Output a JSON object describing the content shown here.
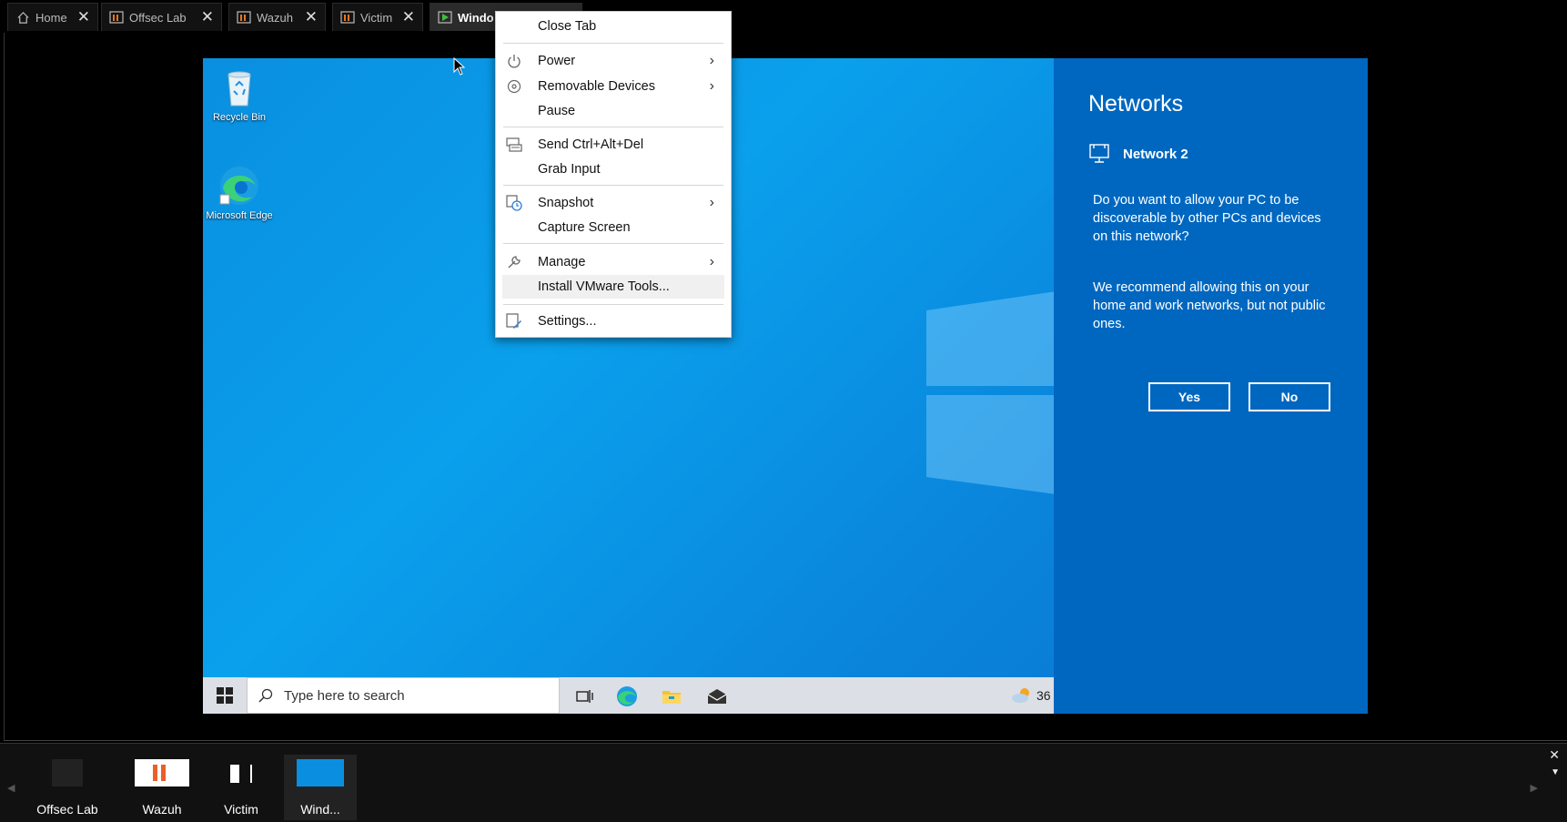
{
  "tabs": [
    {
      "label": "Home",
      "icon": "home-icon",
      "close": "✕"
    },
    {
      "label": "Offsec Lab",
      "icon": "vm-group-icon",
      "close": "✕"
    },
    {
      "label": "Wazuh",
      "icon": "vm-group-icon",
      "close": "✕"
    },
    {
      "label": "Victim",
      "icon": "vm-group-icon",
      "close": "✕"
    },
    {
      "label": "Windo",
      "icon": "vm-running-icon",
      "close": "✕"
    }
  ],
  "desktop": {
    "icons": [
      {
        "label": "Recycle Bin",
        "icon": "recycle-bin-icon"
      },
      {
        "label": "Microsoft Edge",
        "icon": "edge-icon"
      }
    ],
    "taskbar": {
      "search_placeholder": "Type here to search",
      "weather": "36"
    }
  },
  "networks_panel": {
    "title": "Networks",
    "network_name": "Network 2",
    "question": "Do you want to allow your PC to be discoverable by other PCs and devices on this network?",
    "recommendation": "We recommend allowing this on your home and work networks, but not public ones.",
    "yes_label": "Yes",
    "no_label": "No"
  },
  "context_menu": {
    "close_tab": "Close Tab",
    "power": "Power",
    "removable_devices": "Removable Devices",
    "pause": "Pause",
    "send_cad": "Send Ctrl+Alt+Del",
    "grab_input": "Grab Input",
    "snapshot": "Snapshot",
    "capture_screen": "Capture Screen",
    "manage": "Manage",
    "install_tools": "Install VMware Tools...",
    "settings": "Settings...",
    "submenu_arrow": "›"
  },
  "thumbnails": [
    {
      "label": "Offsec Lab"
    },
    {
      "label": "Wazuh"
    },
    {
      "label": "Victim"
    },
    {
      "label": "Wind..."
    }
  ],
  "colors": {
    "desktop_blue": "#0a8fe0",
    "panel_blue": "#0067c0"
  }
}
